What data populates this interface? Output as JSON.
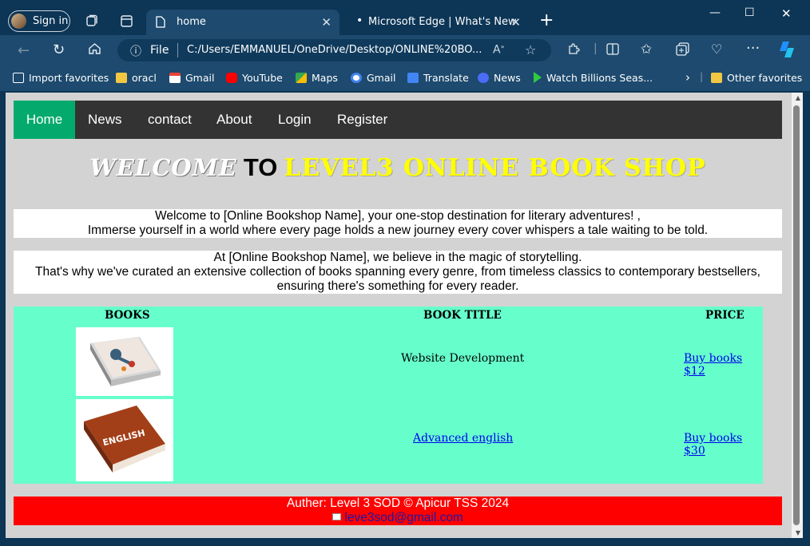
{
  "browser": {
    "profile_label": "Sign in",
    "tabs": [
      {
        "title": "home"
      },
      {
        "title": "Microsoft Edge | What's New"
      }
    ],
    "address": {
      "scheme_label": "File",
      "url": "C:/Users/EMMANUEL/OneDrive/Desktop/ONLINE%20BO..."
    },
    "bookmarks": [
      {
        "label": "Import favorites",
        "icon": "import-icon",
        "color": "#ffffff"
      },
      {
        "label": "oracl",
        "icon": "folder-icon",
        "color": "#f2c744"
      },
      {
        "label": "Gmail",
        "icon": "gmail-icon",
        "color": "#ea4335"
      },
      {
        "label": "YouTube",
        "icon": "youtube-icon",
        "color": "#ff0000"
      },
      {
        "label": "Maps",
        "icon": "maps-icon",
        "color": "#34a853"
      },
      {
        "label": "Gmail",
        "icon": "google-icon",
        "color": "#4285f4"
      },
      {
        "label": "Translate",
        "icon": "translate-icon",
        "color": "#4285f4"
      },
      {
        "label": "News",
        "icon": "news-icon",
        "color": "#4a6cf7"
      },
      {
        "label": "Watch Billions Seas...",
        "icon": "play-icon",
        "color": "#2ecc40"
      }
    ],
    "other_favorites": "Other favorites"
  },
  "site": {
    "nav": [
      "Home",
      "News",
      "contact",
      "About",
      "Login",
      "Register"
    ],
    "nav_active": "#04aa6d",
    "hero": {
      "w1": "WELCOME",
      "w2": "TO",
      "w3": "LEVEL3 ONLINE BOOK SHOP"
    },
    "para1": {
      "line1": "Welcome to [Online Bookshop Name], your one-stop destination for literary adventures! ,",
      "line2": "Immerse yourself in a world where every page holds a new journey every cover whispers a tale waiting to be told."
    },
    "para2": {
      "line1": "At [Online Bookshop Name], we believe in the magic of storytelling.",
      "line2": "That's why we've curated an extensive collection of books spanning every genre, from timeless classics to contemporary bestsellers,",
      "line3": "ensuring there's something for every reader."
    },
    "table": {
      "headers": [
        "BOOKS",
        "BOOK TITLE",
        "PRICE"
      ],
      "rows": [
        {
          "title": "Website Development",
          "title_is_link": false,
          "price": "Buy books $12",
          "cover_label": ""
        },
        {
          "title": "Advanced english",
          "title_is_link": true,
          "price": "Buy books $30",
          "cover_label": "ENGLISH"
        }
      ]
    },
    "footer": {
      "text": "Auther: Level 3 SOD © Apicur TSS 2024",
      "email": "leve3sod@gmail.com"
    }
  }
}
